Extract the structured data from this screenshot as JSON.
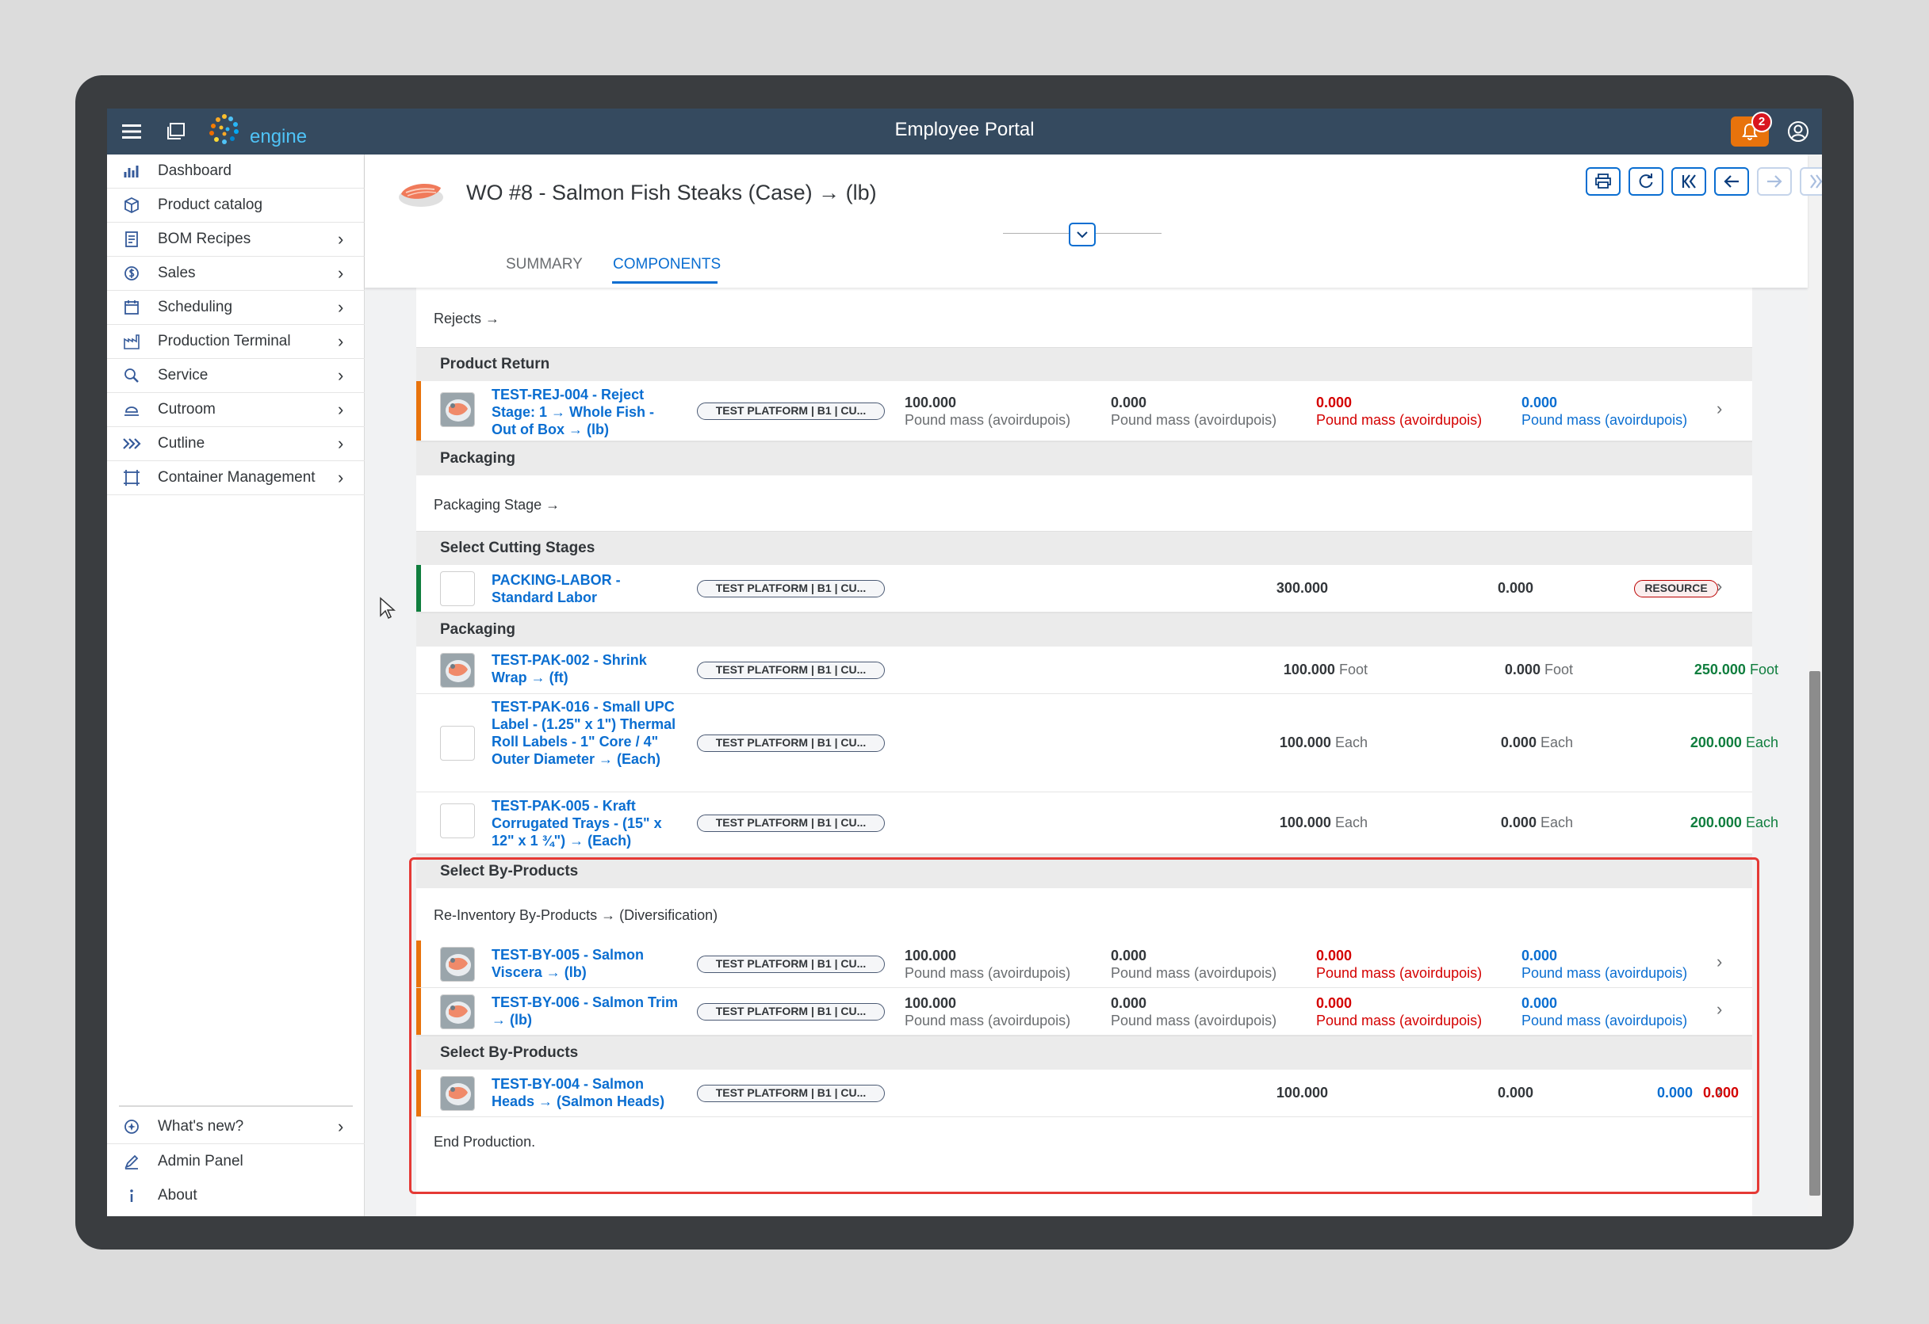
{
  "topbar": {
    "title": "Employee Portal",
    "logo_text": "engine",
    "notification_count": "2"
  },
  "sidebar": {
    "items": [
      {
        "label": "Dashboard",
        "icon": "dashboard-icon",
        "has_children": false
      },
      {
        "label": "Product catalog",
        "icon": "product-catalog-icon",
        "has_children": false
      },
      {
        "label": "BOM Recipes",
        "icon": "bom-recipes-icon",
        "has_children": true
      },
      {
        "label": "Sales",
        "icon": "sales-icon",
        "has_children": true
      },
      {
        "label": "Scheduling",
        "icon": "scheduling-icon",
        "has_children": true
      },
      {
        "label": "Production Terminal",
        "icon": "production-terminal-icon",
        "has_children": true
      },
      {
        "label": "Service",
        "icon": "service-icon",
        "has_children": true
      },
      {
        "label": "Cutroom",
        "icon": "cutroom-icon",
        "has_children": true
      },
      {
        "label": "Cutline",
        "icon": "cutline-icon",
        "has_children": true
      },
      {
        "label": "Container Management",
        "icon": "container-management-icon",
        "has_children": true
      }
    ],
    "bottom_items": [
      {
        "label": "What's new?",
        "icon": "whats-new-icon",
        "has_children": true
      },
      {
        "label": "Admin Panel",
        "icon": "admin-panel-icon",
        "has_children": false
      },
      {
        "label": "About",
        "icon": "info-icon",
        "has_children": false
      }
    ]
  },
  "header": {
    "title": "WO #8 - Salmon Fish Steaks (Case) → (lb)",
    "tabs": [
      {
        "label": "SUMMARY",
        "active": false
      },
      {
        "label": "COMPONENTS",
        "active": true
      }
    ]
  },
  "content": {
    "rejects_text": "Rejects →",
    "product_return_header": "Product Return",
    "packaging_header_1": "Packaging",
    "packaging_stage_text": "Packaging Stage →",
    "cutting_header": "Select Cutting Stages",
    "packaging_header_2": "Packaging",
    "byproducts_header_1": "Select By-Products",
    "reinventory_text": "Re-Inventory By-Products → (Diversification)",
    "byproducts_header_2": "Select By-Products",
    "end_text": "End Production.",
    "tag_text": "TEST PLATFORM | B1 | CU...",
    "resource_tag": "RESOURCE",
    "unit_lb": "Pound mass (avoirdupois)",
    "unit_foot": "Foot",
    "unit_each": "Each",
    "reject_row": {
      "name": "TEST-REJ-004 - Reject Stage: 1 → Whole Fish - Out of Box → (lb)",
      "q1": "100.000",
      "q2": "0.000",
      "q3": "0.000",
      "q4": "0.000"
    },
    "labor_row": {
      "name": "PACKING-LABOR - Standard Labor",
      "q1": "300.000",
      "q2": "0.000"
    },
    "pak_rows": [
      {
        "name": "TEST-PAK-002 - Shrink Wrap → (ft)",
        "q1": "100.000",
        "q2": "0.000",
        "q3": "250.000"
      },
      {
        "name": "TEST-PAK-016 - Small UPC Label - (1.25\" x 1\") Thermal Roll Labels - 1\" Core / 4\" Outer Diameter → (Each)",
        "q1": "100.000",
        "q2": "0.000",
        "q3": "200.000"
      },
      {
        "name": "TEST-PAK-005 - Kraft Corrugated Trays - (15\" x 12\" x 1 ¾\") → (Each)",
        "q1": "100.000",
        "q2": "0.000",
        "q3": "200.000"
      }
    ],
    "by_rows": [
      {
        "name": "TEST-BY-005 - Salmon Viscera → (lb)",
        "q1": "100.000",
        "q2": "0.000",
        "q3": "0.000",
        "q4": "0.000"
      },
      {
        "name": "TEST-BY-006 - Salmon Trim → (lb)",
        "q1": "100.000",
        "q2": "0.000",
        "q3": "0.000",
        "q4": "0.000"
      }
    ],
    "head_row": {
      "name": "TEST-BY-004 - Salmon Heads → (Salmon Heads)",
      "q1": "100.000",
      "q2": "0.000",
      "q3": "0.000",
      "q4": "0.000"
    }
  },
  "colors": {
    "shell": "#354a5f",
    "accent": "#0a6ed1",
    "reject_bar": "#e8730c",
    "labor_bar": "#107e3e",
    "highlight": "#e53935"
  }
}
